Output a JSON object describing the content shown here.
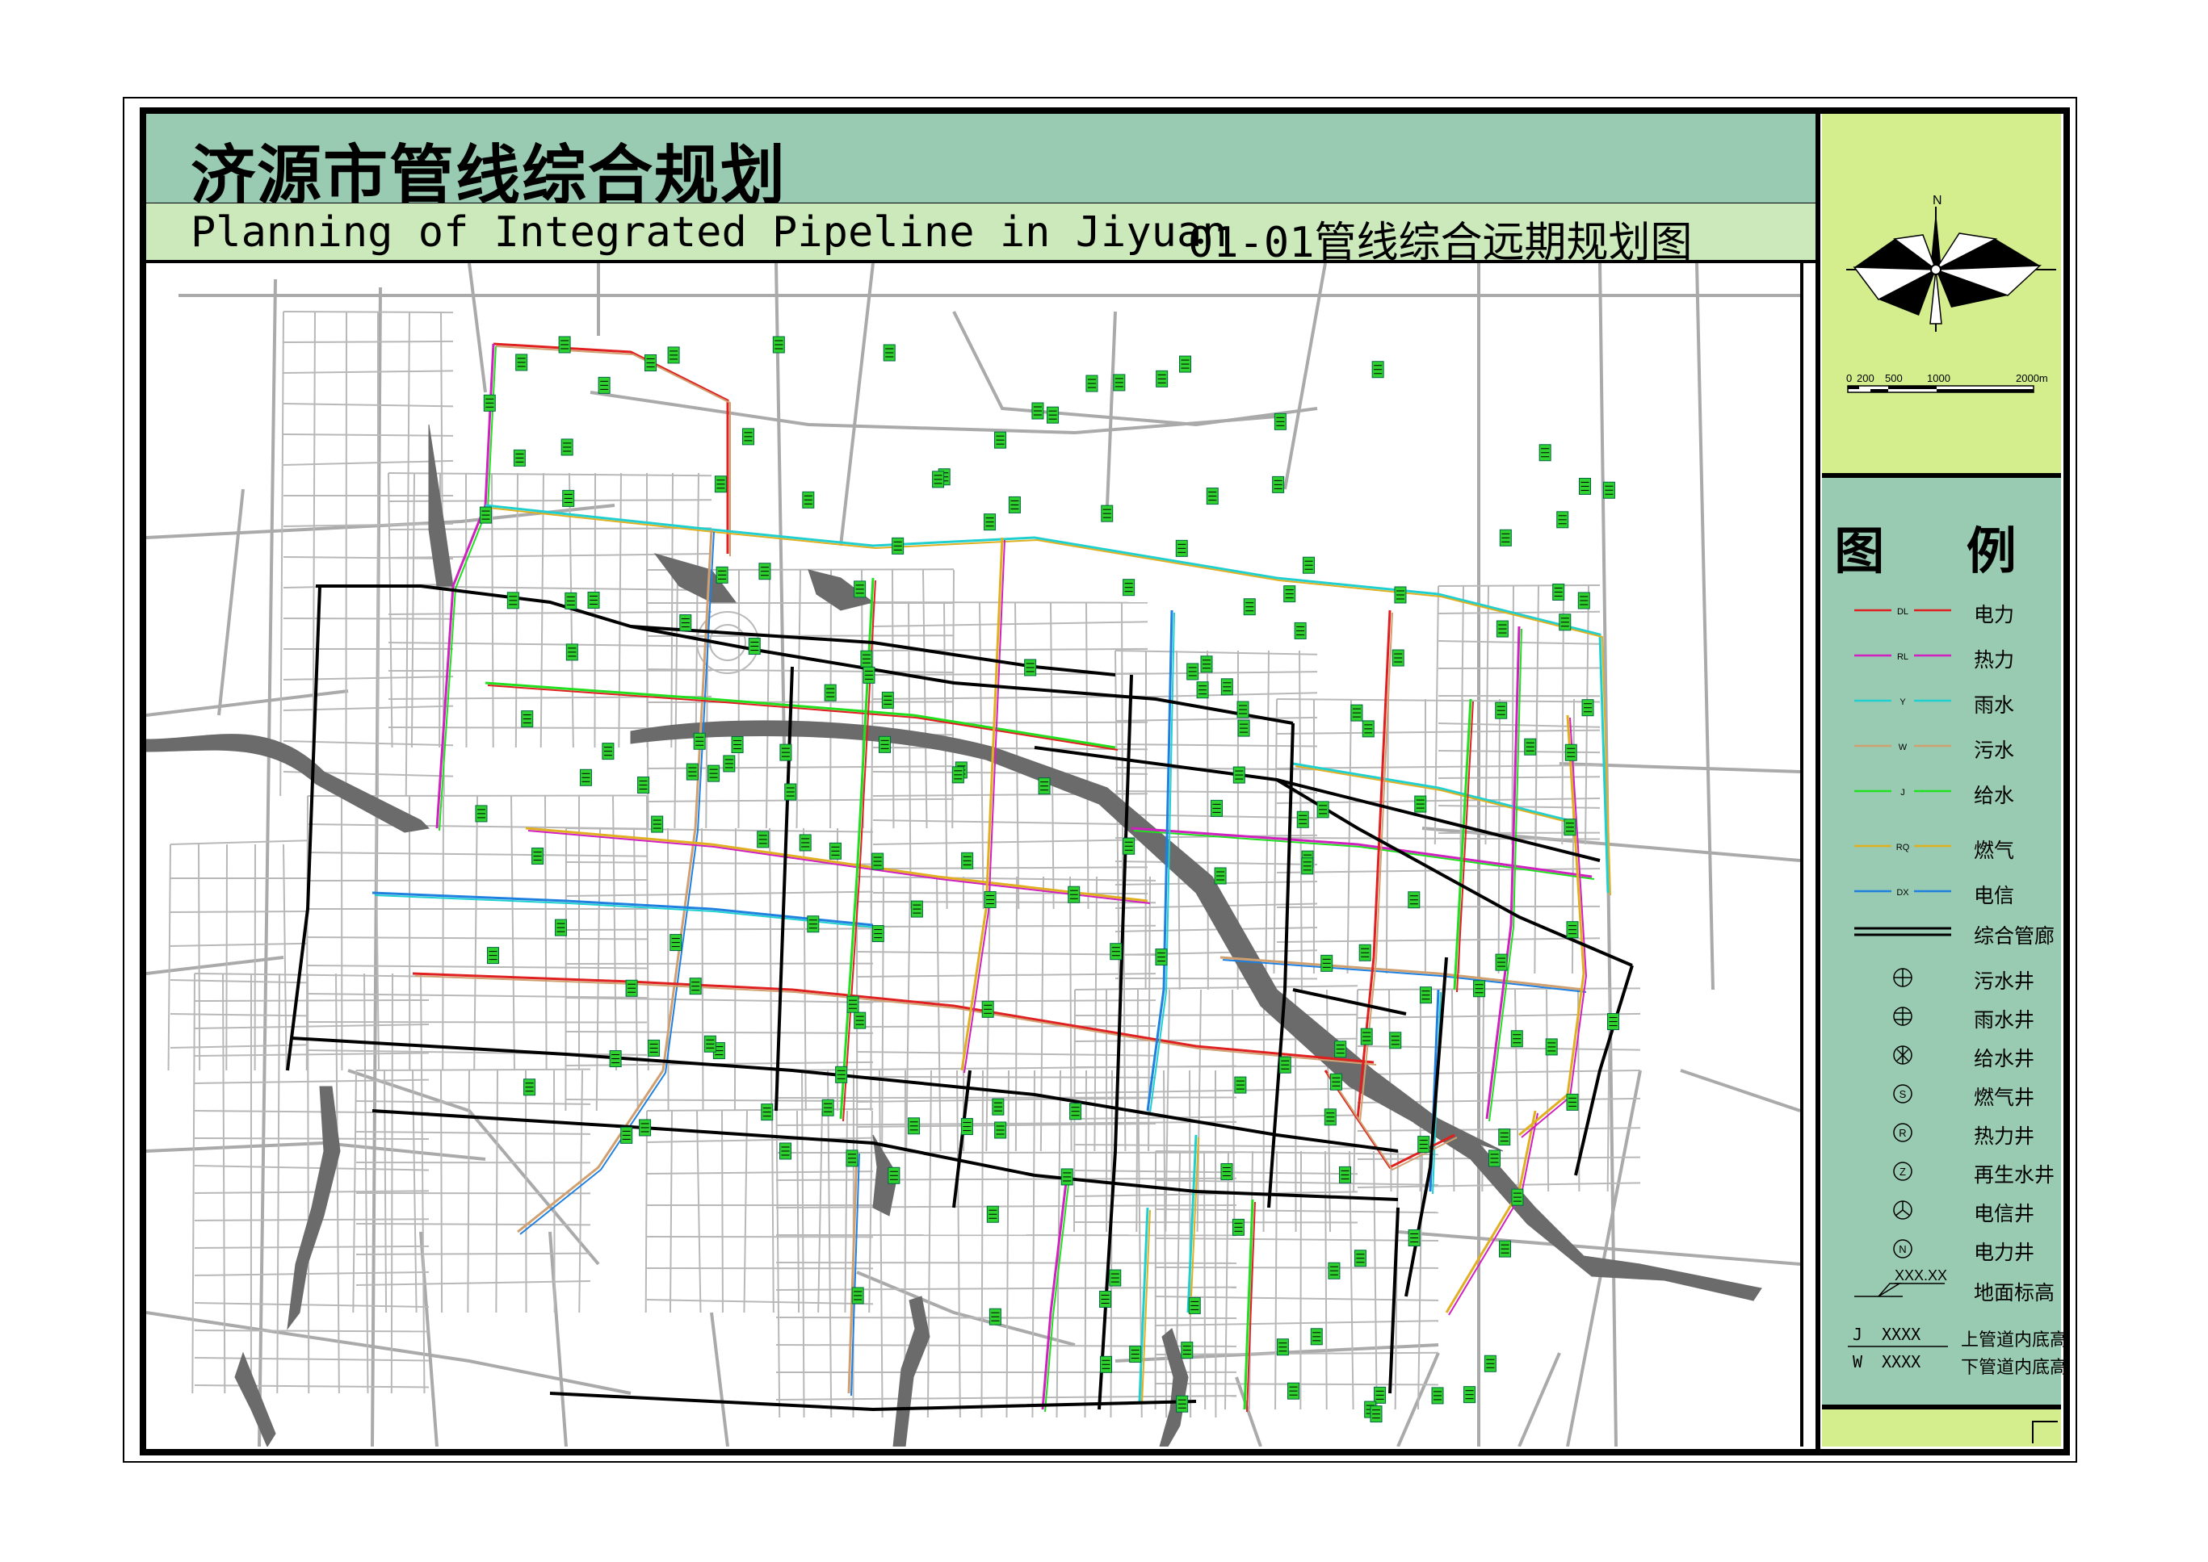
{
  "header": {
    "title_cn": "济源市管线综合规划",
    "title_en": "Planning of Integrated Pipeline in Jiyuan",
    "drawing_title": "01-01管线综合远期规划图"
  },
  "compass": {
    "north_label": "N",
    "scale_labels": [
      "0",
      "200",
      "500",
      "1000",
      "2000m"
    ]
  },
  "legend": {
    "title": "图 例",
    "pipelines": [
      {
        "code": "DL",
        "label": "电力",
        "color": "#e02020"
      },
      {
        "code": "RL",
        "label": "热力",
        "color": "#d020c0"
      },
      {
        "code": "Y",
        "label": "雨水",
        "color": "#20d0d0"
      },
      {
        "code": "W",
        "label": "污水",
        "color": "#d0a070"
      },
      {
        "code": "J",
        "label": "给水",
        "color": "#20e020"
      },
      {
        "code": "RQ",
        "label": "燃气",
        "color": "#e0b020"
      },
      {
        "code": "DX",
        "label": "电信",
        "color": "#2080e0"
      }
    ],
    "corridor_label": "综合管廊",
    "wells": [
      {
        "icon": "sewage-well-icon",
        "label": "污水井"
      },
      {
        "icon": "rain-well-icon",
        "label": "雨水井"
      },
      {
        "icon": "water-supply-well-icon",
        "label": "给水井"
      },
      {
        "icon": "gas-well-icon",
        "label": "燃气井",
        "glyph": "S"
      },
      {
        "icon": "heat-well-icon",
        "label": "热力井",
        "glyph": "R"
      },
      {
        "icon": "reclaimed-water-well-icon",
        "label": "再生水井",
        "glyph": "Z"
      },
      {
        "icon": "telecom-well-icon",
        "label": "电信井"
      },
      {
        "icon": "power-well-icon",
        "label": "电力井",
        "glyph": "N"
      }
    ],
    "ground_elevation": {
      "value": "XXX.XX",
      "label": "地面标高"
    },
    "pipe_invert": {
      "top_code": "J",
      "top_value": "XXXX",
      "top_label": "上管道内底高",
      "bottom_code": "W",
      "bottom_value": "XXXX",
      "bottom_label": "下管道内底高"
    }
  }
}
